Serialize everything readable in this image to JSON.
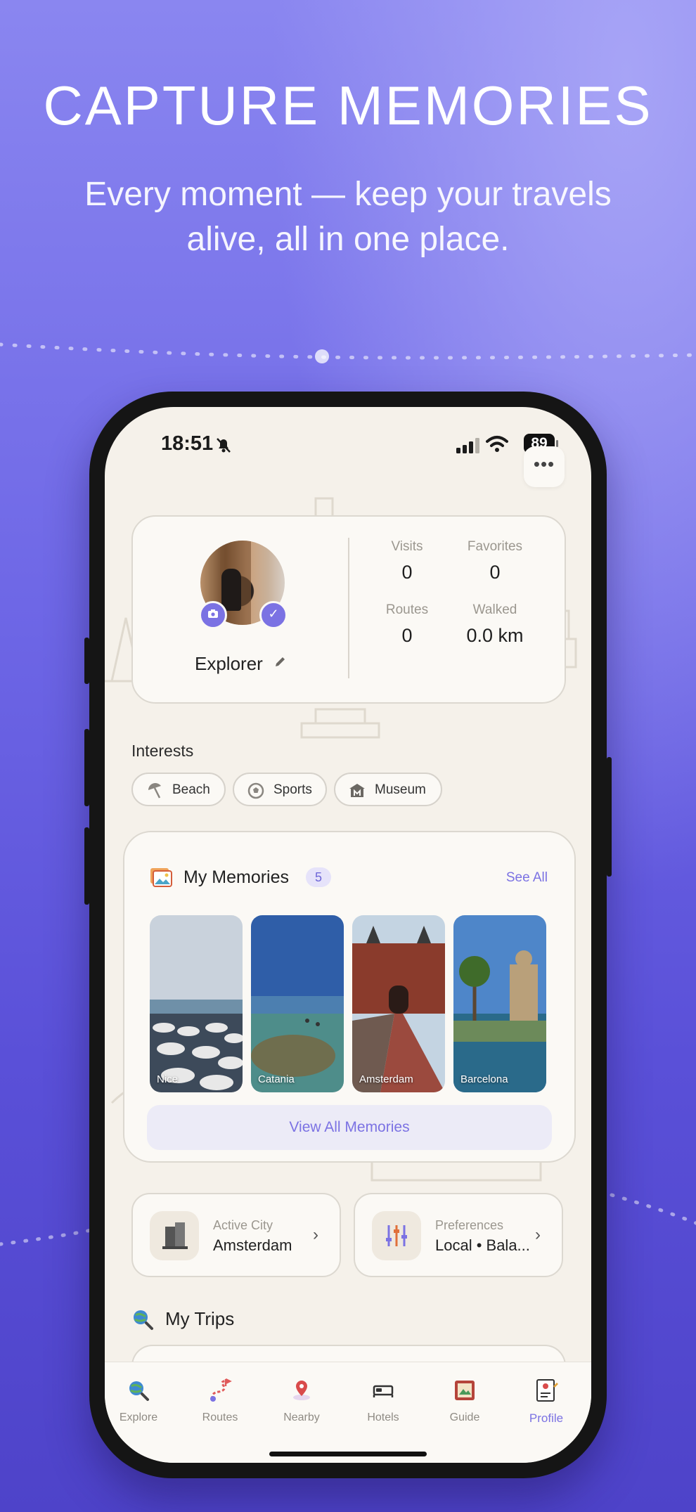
{
  "promo": {
    "headline": "CAPTURE MEMORIES",
    "subline_1": "Every moment — keep your travels",
    "subline_2": "alive, all in one place."
  },
  "status_bar": {
    "time": "18:51",
    "battery": "89"
  },
  "profile": {
    "name": "Explorer",
    "stats": [
      {
        "label": "Visits",
        "value": "0"
      },
      {
        "label": "Favorites",
        "value": "0"
      },
      {
        "label": "Routes",
        "value": "0"
      },
      {
        "label": "Walked",
        "value": "0.0 km"
      }
    ]
  },
  "interests": {
    "title": "Interests",
    "chips": [
      {
        "label": "Beach",
        "icon": "beach-umbrella-icon"
      },
      {
        "label": "Sports",
        "icon": "soccer-ball-icon"
      },
      {
        "label": "Museum",
        "icon": "museum-icon"
      }
    ]
  },
  "memories": {
    "title": "My Memories",
    "count": "5",
    "see_all": "See All",
    "items": [
      {
        "label": "Nice"
      },
      {
        "label": "Catania"
      },
      {
        "label": "Amsterdam"
      },
      {
        "label": "Barcelona"
      }
    ],
    "view_all": "View All Memories"
  },
  "active_city": {
    "label": "Active City",
    "value": "Amsterdam"
  },
  "preferences": {
    "label": "Preferences",
    "value": "Local • Bala..."
  },
  "trips": {
    "title": "My Trips"
  },
  "tabs": [
    {
      "label": "Explore",
      "icon": "globe-search-icon"
    },
    {
      "label": "Routes",
      "icon": "route-icon"
    },
    {
      "label": "Nearby",
      "icon": "map-pin-icon"
    },
    {
      "label": "Hotels",
      "icon": "bed-icon"
    },
    {
      "label": "Guide",
      "icon": "guide-book-icon"
    },
    {
      "label": "Profile",
      "icon": "profile-document-icon"
    }
  ],
  "colors": {
    "accent": "#7b72e3",
    "background_top": "#8a86f0",
    "background_bottom": "#4e43c9",
    "screen": "#f5f1ea"
  }
}
